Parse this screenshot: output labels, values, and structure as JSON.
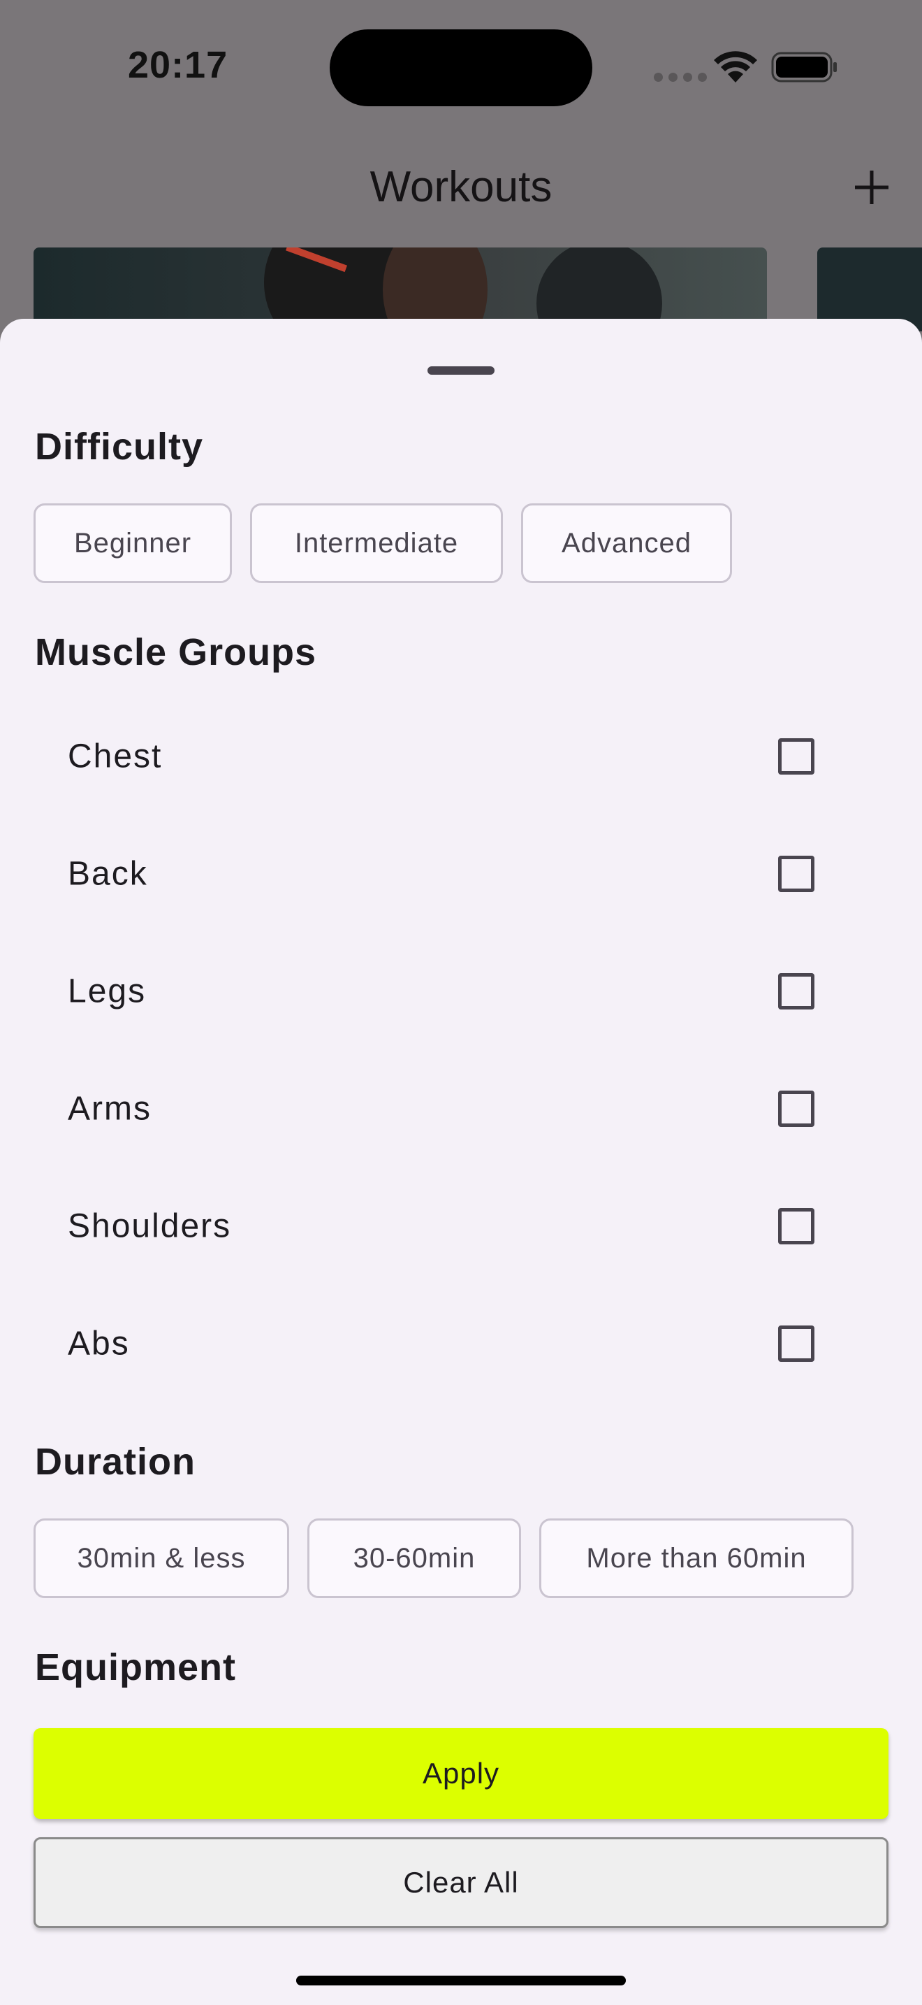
{
  "status_bar": {
    "time": "20:17"
  },
  "nav": {
    "title": "Workouts",
    "add_icon": "plus-icon"
  },
  "sheet": {
    "difficulty": {
      "title": "Difficulty",
      "options": [
        "Beginner",
        "Intermediate",
        "Advanced"
      ]
    },
    "muscle_groups": {
      "title": "Muscle Groups",
      "items": [
        {
          "label": "Chest",
          "checked": false
        },
        {
          "label": "Back",
          "checked": false
        },
        {
          "label": "Legs",
          "checked": false
        },
        {
          "label": "Arms",
          "checked": false
        },
        {
          "label": "Shoulders",
          "checked": false
        },
        {
          "label": "Abs",
          "checked": false
        }
      ]
    },
    "duration": {
      "title": "Duration",
      "options": [
        "30min & less",
        "30-60min",
        "More than 60min"
      ]
    },
    "equipment": {
      "title": "Equipment"
    },
    "apply_label": "Apply",
    "clear_label": "Clear All"
  },
  "colors": {
    "accent": "#dcff00",
    "sheet_background": "#f5f1f8",
    "scrim": "#7a7679"
  }
}
